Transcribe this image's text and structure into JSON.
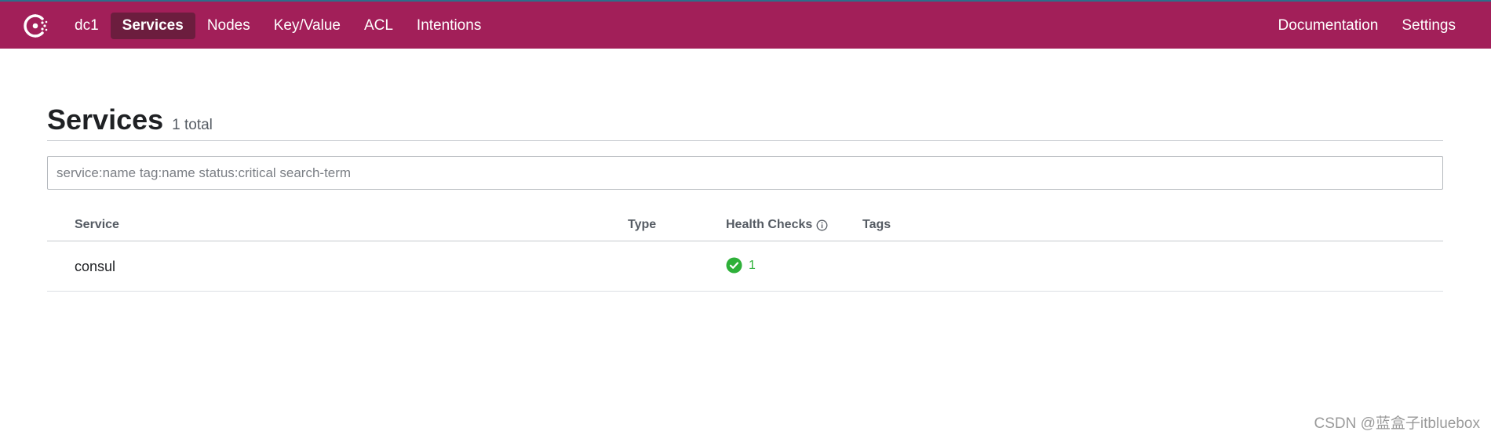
{
  "nav": {
    "logo_icon": "consul-logo-icon",
    "datacenter": "dc1",
    "items": [
      {
        "label": "Services",
        "active": true
      },
      {
        "label": "Nodes",
        "active": false
      },
      {
        "label": "Key/Value",
        "active": false
      },
      {
        "label": "ACL",
        "active": false
      },
      {
        "label": "Intentions",
        "active": false
      }
    ],
    "right_items": [
      {
        "label": "Documentation"
      },
      {
        "label": "Settings"
      }
    ],
    "colors": {
      "bar": "#a21f59",
      "active_item": "#6c1d3e"
    }
  },
  "page": {
    "title": "Services",
    "count": "1 total"
  },
  "search": {
    "placeholder": "service:name tag:name status:critical search-term",
    "value": ""
  },
  "table": {
    "columns": {
      "service": "Service",
      "type": "Type",
      "health": "Health Checks",
      "tags": "Tags"
    },
    "rows": [
      {
        "service": "consul",
        "type": "",
        "health_passing": "1",
        "health_icon": "check-circle-icon",
        "tags": ""
      }
    ],
    "colors": {
      "passing": "#2eb039"
    }
  },
  "watermark": "CSDN @蓝盒子itbluebox"
}
